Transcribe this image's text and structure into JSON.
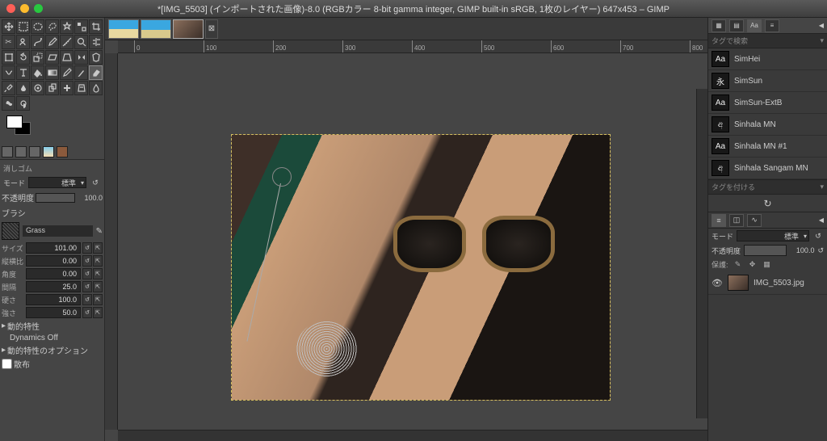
{
  "title": "*[IMG_5503] (インポートされた画像)-8.0 (RGBカラー 8-bit gamma integer, GIMP built-in sRGB, 1枚のレイヤー) 647x453 – GIMP",
  "tool_options": {
    "tool_name": "消しゴム",
    "mode_label": "モード",
    "mode_value": "標準",
    "opacity_label": "不透明度",
    "opacity_value": "100.0",
    "brush_label": "ブラシ",
    "brush_name": "Grass",
    "size_label": "サイズ",
    "size_value": "101.00",
    "aspect_label": "縦横比",
    "aspect_value": "0.00",
    "angle_label": "角度",
    "angle_value": "0.00",
    "spacing_label": "間隔",
    "spacing_value": "25.0",
    "hardness_label": "硬さ",
    "hardness_value": "100.0",
    "force_label": "強さ",
    "force_value": "50.0",
    "dynamics_header": "動的特性",
    "dynamics_value": "Dynamics Off",
    "dynamics_options": "動的特性のオプション",
    "scatter_label": "散布"
  },
  "ruler_ticks": [
    "0",
    "100",
    "200",
    "300",
    "400",
    "500",
    "600",
    "700",
    "800"
  ],
  "fonts": {
    "search_placeholder": "タグで検索",
    "items": [
      {
        "sample": "Aa",
        "name": "SimHei"
      },
      {
        "sample": "永",
        "name": "SimSun"
      },
      {
        "sample": "Aa",
        "name": "SimSun-ExtB"
      },
      {
        "sample": "අ",
        "name": "Sinhala MN"
      },
      {
        "sample": "Aa",
        "name": "Sinhala MN #1"
      },
      {
        "sample": "අ",
        "name": "Sinhala Sangam MN"
      }
    ],
    "tag_placeholder": "タグを付ける"
  },
  "layers": {
    "mode_label": "モード",
    "mode_value": "標準",
    "opacity_label": "不透明度",
    "opacity_value": "100.0",
    "lock_label": "保護:",
    "items": [
      {
        "name": "IMG_5503.jpg"
      }
    ]
  }
}
